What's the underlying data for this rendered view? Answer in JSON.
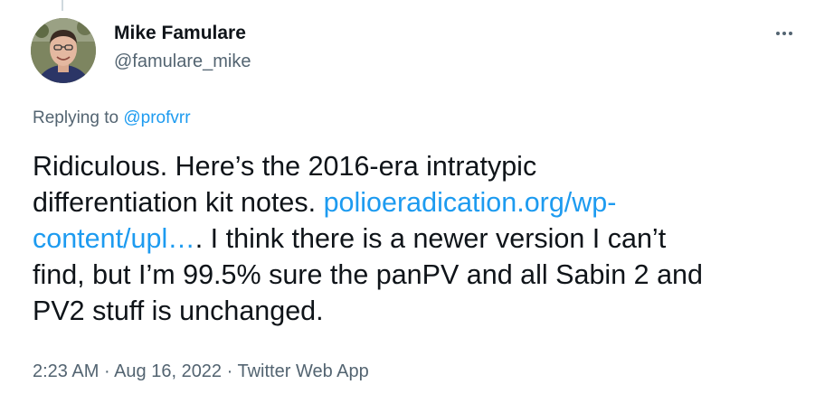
{
  "author": {
    "name": "Mike Famulare",
    "handle": "@famulare_mike",
    "avatar_icon": "profile-photo"
  },
  "reply": {
    "prefix": "Replying to ",
    "mention": "@profvrr"
  },
  "tweet": {
    "line1": "Ridiculous. Here’s the 2016-era intratypic",
    "line2_text": "differentiation kit notes. ",
    "line2_link": "polioeradication.org/wp-",
    "line3_link": "content/upl…",
    "line3_text": ". I think there is a newer version I can’t",
    "line4": "find, but I’m 99.5% sure the panPV and all Sabin 2 and",
    "line5": "PV2 stuff is unchanged."
  },
  "meta": {
    "time": "2:23 AM",
    "sep1": " · ",
    "date": "Aug 16, 2022",
    "sep2": " · ",
    "source": "Twitter Web App"
  },
  "colors": {
    "link": "#1d9bf0",
    "secondary_text": "#536471",
    "primary_text": "#0f1419"
  },
  "icons": {
    "more": "more-horizontal-icon"
  }
}
